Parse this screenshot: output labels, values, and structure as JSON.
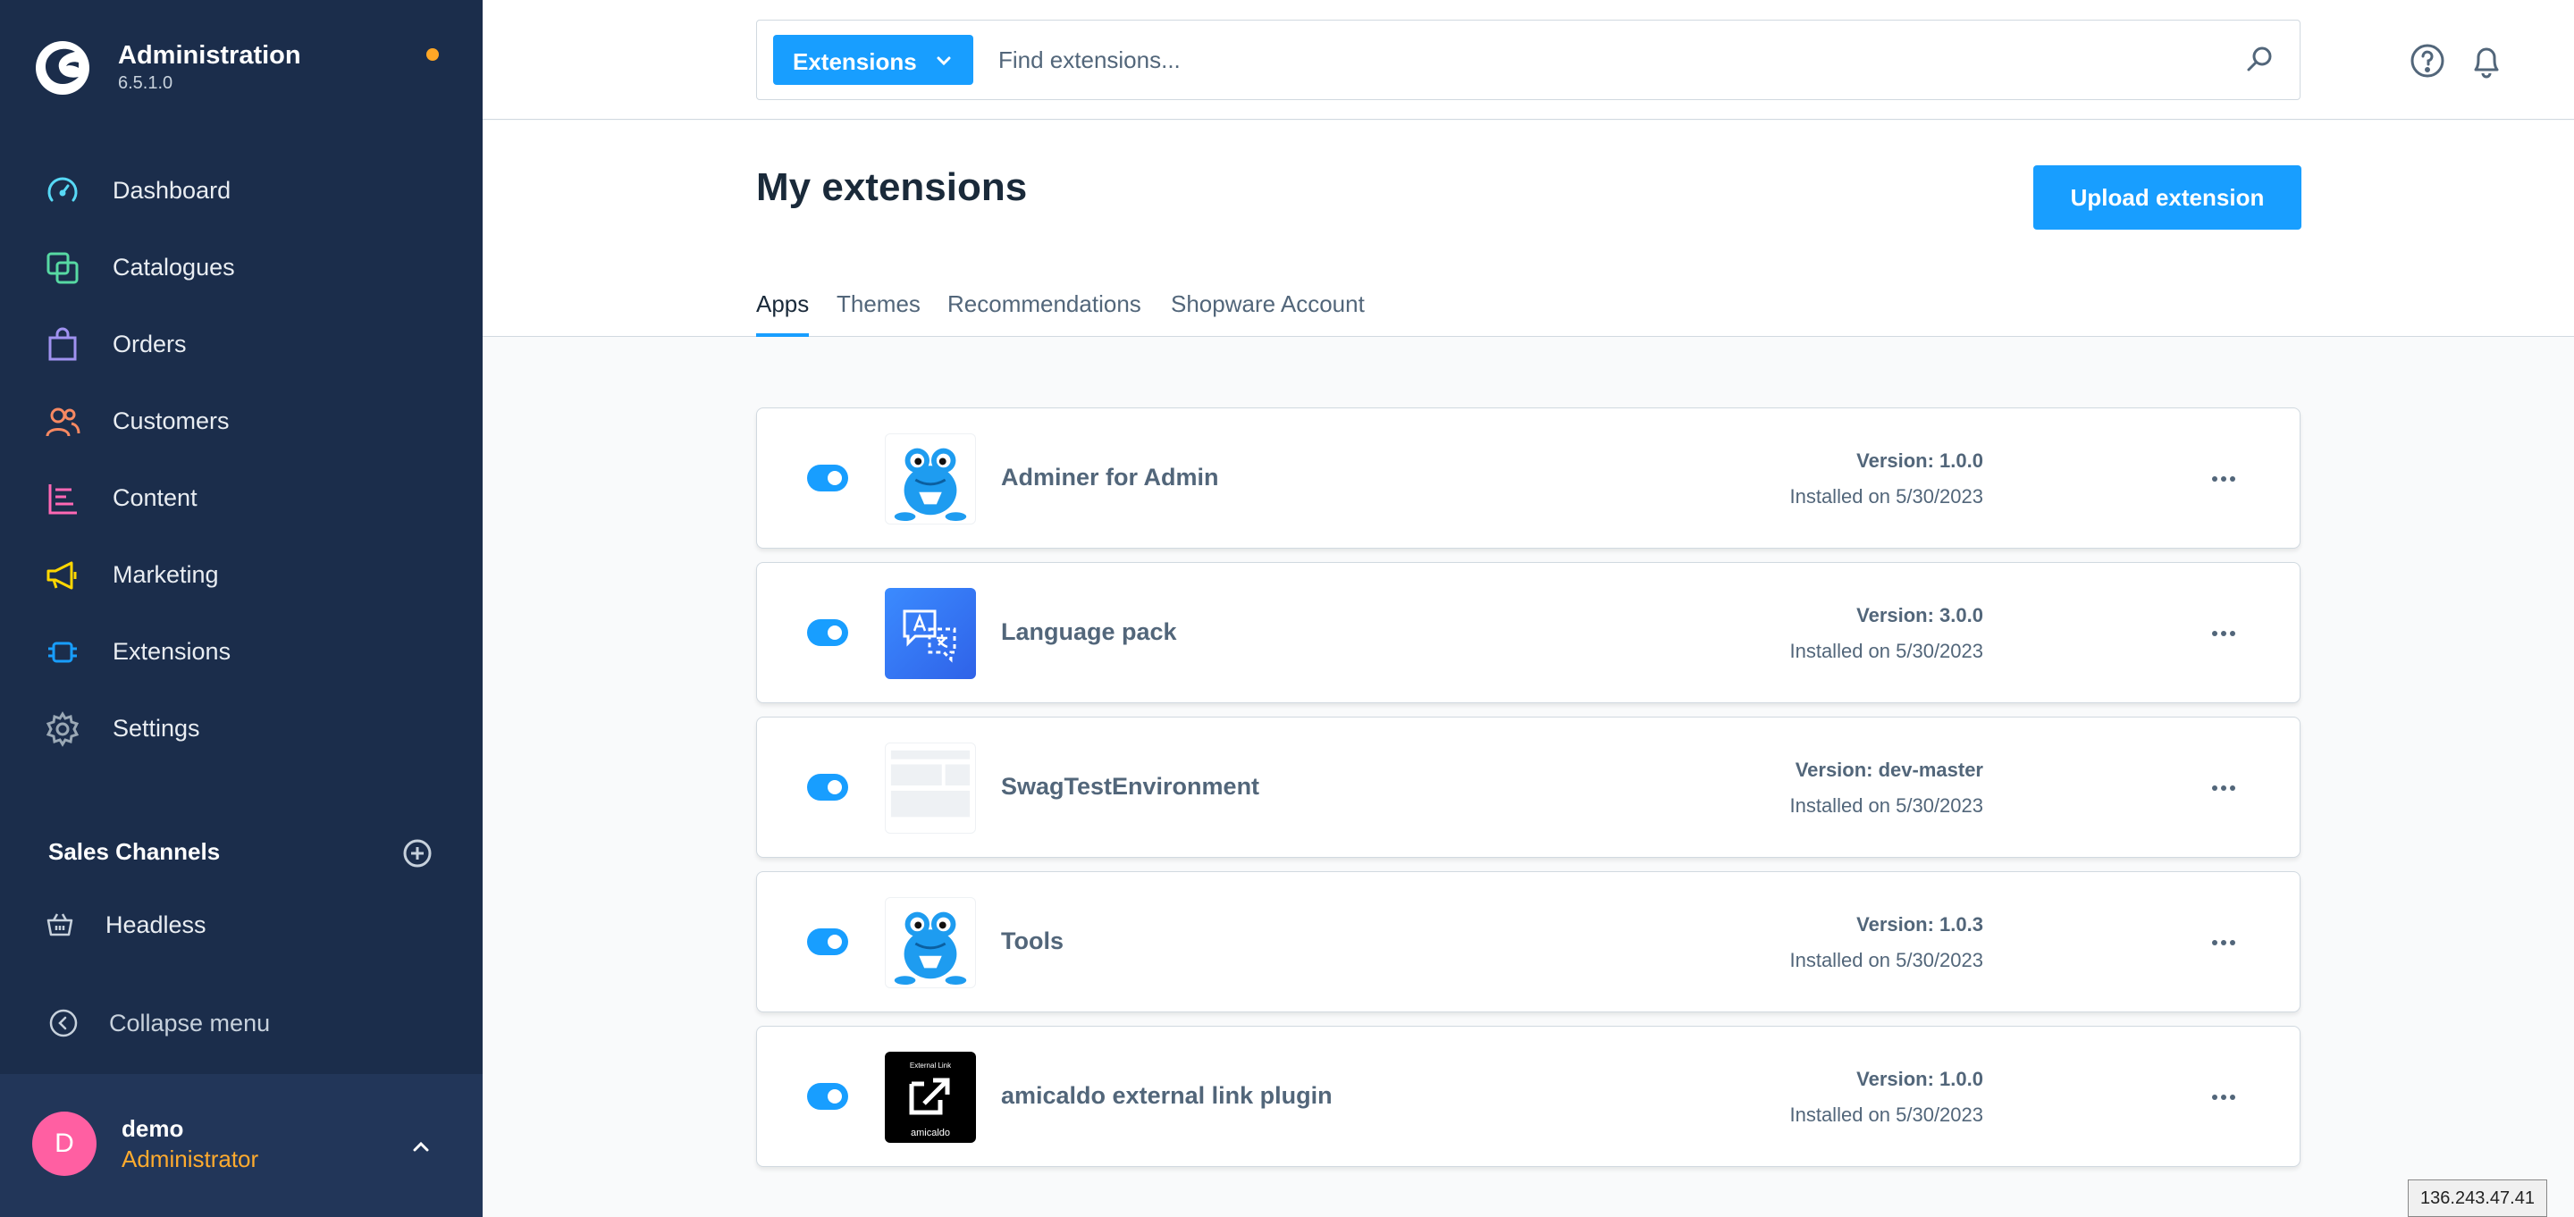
{
  "app": {
    "title": "Administration",
    "version": "6.5.1.0"
  },
  "nav": [
    {
      "label": "Dashboard",
      "icon": "dashboard-icon",
      "color": "#57d9f6"
    },
    {
      "label": "Catalogues",
      "icon": "catalogues-icon",
      "color": "#57d9a3"
    },
    {
      "label": "Orders",
      "icon": "orders-icon",
      "color": "#a092f0"
    },
    {
      "label": "Customers",
      "icon": "customers-icon",
      "color": "#f88962"
    },
    {
      "label": "Content",
      "icon": "content-icon",
      "color": "#ff68b4"
    },
    {
      "label": "Marketing",
      "icon": "marketing-icon",
      "color": "#ffd700"
    },
    {
      "label": "Extensions",
      "icon": "extensions-icon",
      "color": "#189eff"
    },
    {
      "label": "Settings",
      "icon": "settings-icon",
      "color": "#9aa8b5"
    }
  ],
  "sales_channels": {
    "title": "Sales Channels",
    "items": [
      {
        "label": "Headless"
      }
    ]
  },
  "collapse_label": "Collapse menu",
  "user": {
    "initial": "D",
    "name": "demo",
    "role": "Administrator"
  },
  "search": {
    "type": "Extensions",
    "placeholder": "Find extensions..."
  },
  "page": {
    "title": "My extensions",
    "upload_label": "Upload extension",
    "tabs": [
      "Apps",
      "Themes",
      "Recommendations",
      "Shopware Account"
    ],
    "active_tab": "Apps"
  },
  "extensions": [
    {
      "name": "Adminer for Admin",
      "version": "Version: 1.0.0",
      "installed": "Installed on 5/30/2023",
      "icon": "frog-icon",
      "active": true
    },
    {
      "name": "Language pack",
      "version": "Version: 3.0.0",
      "installed": "Installed on 5/30/2023",
      "icon": "language-pack-icon",
      "active": true
    },
    {
      "name": "SwagTestEnvironment",
      "version": "Version: dev-master",
      "installed": "Installed on 5/30/2023",
      "icon": "placeholder-icon",
      "active": true
    },
    {
      "name": "Tools",
      "version": "Version: 1.0.3",
      "installed": "Installed on 5/30/2023",
      "icon": "frog-icon",
      "active": true
    },
    {
      "name": "amicaldo external link plugin",
      "version": "Version: 1.0.0",
      "installed": "Installed on 5/30/2023",
      "icon": "external-link-icon",
      "active": true,
      "icon_caption": "External Link",
      "icon_brand": "amicaldo"
    }
  ],
  "ip_address": "136.243.47.41",
  "colors": {
    "sidebar": "#1b2d4b",
    "accent": "#189eff",
    "status_dot": "#ffa726",
    "role": "#ffab2e",
    "avatar": "#ff5fa2"
  }
}
